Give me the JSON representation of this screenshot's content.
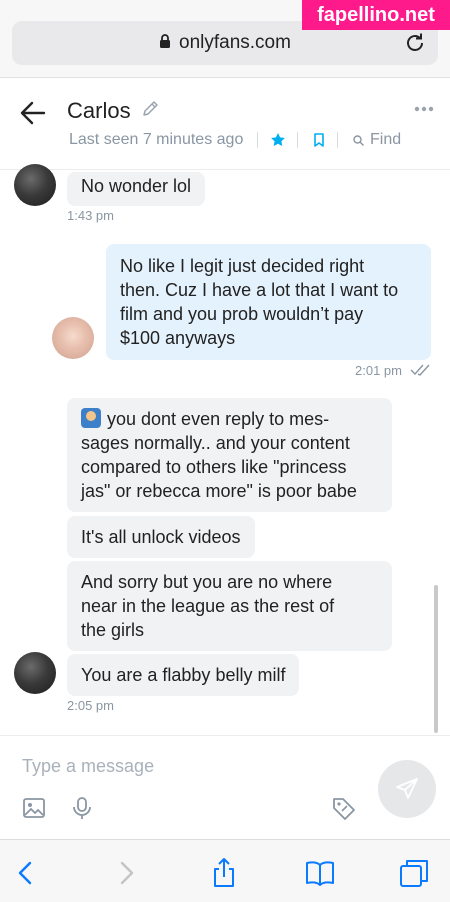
{
  "browser": {
    "url": "onlyfans.com",
    "watermark": "fapellino.net"
  },
  "header": {
    "name": "Carlos",
    "last_seen": "Last seen 7 minutes ago",
    "find_label": "Find"
  },
  "messages": [
    {
      "from": "contact",
      "text": "No wonder lol",
      "time": "1:43 pm"
    },
    {
      "from": "me",
      "lines": [
        "No like I legit just decided right",
        "then. Cuz I have a lot that I want to",
        "film and you prob wouldn’t pay",
        "$100 anyways"
      ],
      "time": "2:01 pm"
    },
    {
      "from": "contact",
      "lines": [
        "you dont even reply to mes-",
        "sages normally.. and your content",
        "compared to others like \"princess",
        "jas\" or rebecca more\" is poor babe"
      ]
    },
    {
      "from": "contact",
      "text": "It's all unlock videos"
    },
    {
      "from": "contact",
      "lines": [
        "And sorry but you are no where",
        "near in the league as the rest of",
        "the girls"
      ]
    },
    {
      "from": "contact",
      "text": "You are a flabby belly milf",
      "time": "2:05 pm"
    }
  ],
  "composer": {
    "placeholder": "Type a message"
  },
  "icons": {
    "lock": "lock-icon",
    "reload": "reload-icon",
    "back": "arrow-left-icon",
    "edit": "pencil-icon",
    "more": "more-dots-icon",
    "star": "star-icon",
    "bookmark": "bookmark-icon",
    "find": "search-icon",
    "image": "image-icon",
    "mic": "microphone-icon",
    "price": "price-tag-icon",
    "send": "send-icon",
    "browser_back": "chevron-left-icon",
    "browser_forward": "chevron-right-icon",
    "share": "share-icon",
    "bookmarks": "book-icon",
    "tabs": "tabs-icon"
  },
  "colors": {
    "accent": "#00aff0",
    "incoming_bubble": "#f1f2f4",
    "outgoing_bubble": "#e4f2fd",
    "muted_text": "#8a96a3",
    "watermark": "#ff1a8c"
  }
}
